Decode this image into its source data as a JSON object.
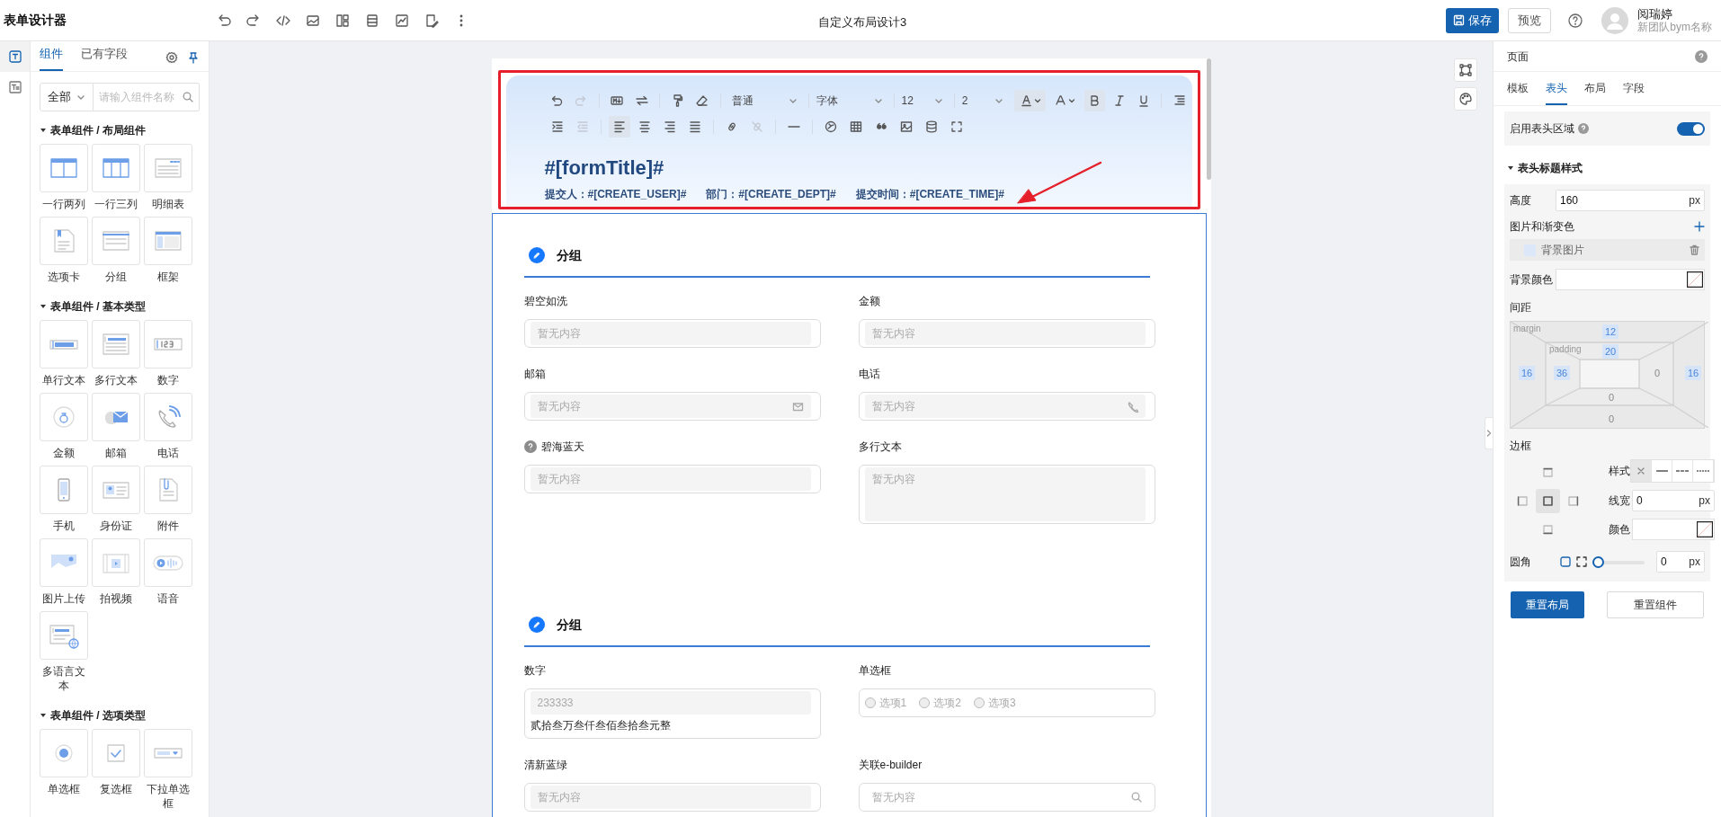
{
  "app": {
    "title": "表单设计器"
  },
  "document_title": "自定义布局设计3",
  "actions": [
    {
      "label": "保存",
      "kind": "primary"
    },
    {
      "label": "预览",
      "kind": "default"
    }
  ],
  "user": {
    "name": "阅瑞婷",
    "team": "新团队bym名称"
  },
  "left_rail": [
    {
      "kind": "component",
      "selected": true
    },
    {
      "kind": "field",
      "selected": false
    }
  ],
  "left_panel": {
    "tabs": [
      {
        "label": "组件",
        "selected": true
      },
      {
        "label": "已有字段",
        "selected": false
      }
    ],
    "filter": {
      "value": "全部"
    },
    "search": {
      "placeholder": "请输入组件名称"
    },
    "groups": [
      {
        "title": "表单组件 / 布局组件",
        "expanded": true,
        "items": [
          {
            "label": "一行两列",
            "kind": "two-col"
          },
          {
            "label": "一行三列",
            "kind": "three-col"
          },
          {
            "label": "明细表",
            "kind": "detail"
          },
          {
            "label": "选项卡",
            "kind": "tabs"
          },
          {
            "label": "分组",
            "kind": "group"
          },
          {
            "label": "框架",
            "kind": "frame"
          }
        ]
      },
      {
        "title": "表单组件 / 基本类型",
        "expanded": true,
        "items": [
          {
            "label": "单行文本",
            "kind": "input"
          },
          {
            "label": "多行文本",
            "kind": "textarea"
          },
          {
            "label": "数字",
            "kind": "number"
          },
          {
            "label": "金额",
            "kind": "money"
          },
          {
            "label": "邮箱",
            "kind": "mail"
          },
          {
            "label": "电话",
            "kind": "phone"
          },
          {
            "label": "手机",
            "kind": "mobile"
          },
          {
            "label": "身份证",
            "kind": "idcard"
          },
          {
            "label": "附件",
            "kind": "file"
          },
          {
            "label": "图片上传",
            "kind": "image"
          },
          {
            "label": "拍视频",
            "kind": "video"
          },
          {
            "label": "语音",
            "kind": "voice"
          },
          {
            "label": "多语言文本",
            "kind": "i18n"
          }
        ]
      },
      {
        "title": "表单组件 / 选项类型",
        "expanded": true,
        "items": [
          {
            "label": "单选框",
            "kind": "radio"
          },
          {
            "label": "复选框",
            "kind": "checkbox"
          },
          {
            "label": "下拉单选框",
            "kind": "select"
          }
        ]
      }
    ]
  },
  "header": {
    "toolbar": [
      {
        "kind": "undo",
        "active": false,
        "disabled": false
      },
      {
        "kind": "redo",
        "active": false,
        "disabled": true
      },
      {
        "kind": "sep"
      },
      {
        "kind": "markdown",
        "active": false,
        "disabled": false
      },
      {
        "kind": "swap",
        "active": false,
        "disabled": false
      },
      {
        "kind": "sep"
      },
      {
        "kind": "painter",
        "active": false,
        "disabled": false
      },
      {
        "kind": "eraser",
        "active": false,
        "disabled": false
      },
      {
        "kind": "sep"
      },
      {
        "kind": "select",
        "value": "普通"
      },
      {
        "kind": "select",
        "value": "字体"
      },
      {
        "kind": "select",
        "value": "12"
      },
      {
        "kind": "select",
        "value": "2"
      },
      {
        "kind": "font-color",
        "active": true,
        "disabled": false
      },
      {
        "kind": "bg-color",
        "active": false,
        "disabled": false
      },
      {
        "kind": "bold",
        "active": true,
        "disabled": false
      },
      {
        "kind": "italic",
        "active": false,
        "disabled": false
      },
      {
        "kind": "underline",
        "active": false,
        "disabled": false
      },
      {
        "kind": "sep"
      },
      {
        "kind": "line-height",
        "active": false,
        "disabled": false
      },
      {
        "kind": "indent",
        "active": false,
        "disabled": false
      },
      {
        "kind": "outdent",
        "active": false,
        "disabled": true
      },
      {
        "kind": "sep"
      },
      {
        "kind": "align-left",
        "active": true,
        "disabled": false
      },
      {
        "kind": "align-center",
        "active": false,
        "disabled": false
      },
      {
        "kind": "align-right",
        "active": false,
        "disabled": false
      },
      {
        "kind": "justify",
        "active": false,
        "disabled": false
      },
      {
        "kind": "sep"
      },
      {
        "kind": "link",
        "active": false,
        "disabled": false
      },
      {
        "kind": "unlink",
        "active": false,
        "disabled": true
      },
      {
        "kind": "sep"
      },
      {
        "kind": "hr",
        "active": false,
        "disabled": false
      },
      {
        "kind": "sep"
      },
      {
        "kind": "emoji",
        "active": false,
        "disabled": false
      },
      {
        "kind": "table",
        "active": false,
        "disabled": false
      },
      {
        "kind": "quote",
        "active": false,
        "disabled": false
      },
      {
        "kind": "picture",
        "active": false,
        "disabled": false
      },
      {
        "kind": "database",
        "active": false,
        "disabled": false
      },
      {
        "kind": "fullscreen",
        "active": false,
        "disabled": false
      }
    ],
    "title": "#[formTitle]#",
    "meta": [
      "提交人：#[CREATE_USER]#",
      "部门：#[CREATE_DEPT]#",
      "提交时间：#[CREATE_TIME]#"
    ],
    "highlighted": true
  },
  "sections": [
    {
      "title": "分组",
      "fields": [
        {
          "label": "碧空如洗",
          "kind": "text",
          "placeholder": "暂无内容",
          "help": false
        },
        {
          "label": "金额",
          "kind": "text",
          "placeholder": "暂无内容",
          "help": false
        },
        {
          "label": "邮箱",
          "kind": "email",
          "placeholder": "暂无内容",
          "help": false
        },
        {
          "label": "电话",
          "kind": "phone",
          "placeholder": "暂无内容",
          "help": false
        },
        {
          "label": "碧海蓝天",
          "kind": "text",
          "placeholder": "暂无内容",
          "help": true
        },
        {
          "label": "多行文本",
          "kind": "textarea",
          "placeholder": "暂无内容",
          "help": false
        }
      ]
    },
    {
      "title": "分组",
      "fields": [
        {
          "label": "数字",
          "kind": "number",
          "value": "233333",
          "caption": "贰拾叁万叁仟叁佰叁拾叁元整",
          "help": false
        },
        {
          "label": "单选框",
          "kind": "radio",
          "options": [
            {
              "label": "选项1",
              "selected": false
            },
            {
              "label": "选项2",
              "selected": false
            },
            {
              "label": "选项3",
              "selected": false
            }
          ],
          "help": false
        },
        {
          "label": "清新蓝绿",
          "kind": "text",
          "placeholder": "暂无内容",
          "help": false
        },
        {
          "label": "关联e-builder",
          "kind": "search",
          "placeholder": "暂无内容",
          "help": false
        }
      ]
    }
  ],
  "right_panel": {
    "title": "页面",
    "tabs": [
      {
        "label": "模板",
        "selected": false
      },
      {
        "label": "表头",
        "selected": true
      },
      {
        "label": "布局",
        "selected": false
      },
      {
        "label": "字段",
        "selected": false
      }
    ],
    "enable_header": {
      "label": "启用表头区域",
      "on": true
    },
    "section": {
      "title": "表头标题样式",
      "expanded": true
    },
    "height": {
      "label": "高度",
      "value": "160",
      "unit": "px"
    },
    "background": {
      "label": "图片和渐变色",
      "layers": [
        "背景图片"
      ]
    },
    "bg_color": {
      "label": "背景颜色"
    },
    "spacing": {
      "label": "间距",
      "margin": {
        "label": "margin",
        "top": {
          "value": "12",
          "set": true
        },
        "right": {
          "value": "16",
          "set": true
        },
        "bottom": {
          "value": "0",
          "set": false
        },
        "left": {
          "value": "16",
          "set": true
        }
      },
      "padding": {
        "label": "padding",
        "top": {
          "value": "20",
          "set": true
        },
        "right": {
          "value": "0",
          "set": false
        },
        "bottom": {
          "value": "0",
          "set": false
        },
        "left": {
          "value": "36",
          "set": true
        }
      }
    },
    "border": {
      "label": "边框",
      "sides": [
        {
          "kind": "top",
          "selected": false
        },
        {
          "kind": "left",
          "selected": false
        },
        {
          "kind": "all",
          "selected": true
        },
        {
          "kind": "right",
          "selected": false
        },
        {
          "kind": "bottom",
          "selected": false
        }
      ],
      "style": {
        "label": "样式",
        "options": [
          {
            "kind": "none",
            "selected": true
          },
          {
            "kind": "solid",
            "selected": false
          },
          {
            "kind": "dashed",
            "selected": false
          },
          {
            "kind": "dotted",
            "selected": false
          }
        ]
      },
      "width": {
        "label": "线宽",
        "value": "0",
        "unit": "px"
      },
      "color": {
        "label": "颜色"
      }
    },
    "radius": {
      "label": "圆角",
      "value": "0",
      "unit": "px",
      "level": 0
    },
    "buttons": [
      {
        "label": "重置布局",
        "kind": "primary"
      },
      {
        "label": "重置组件",
        "kind": "default"
      }
    ]
  }
}
